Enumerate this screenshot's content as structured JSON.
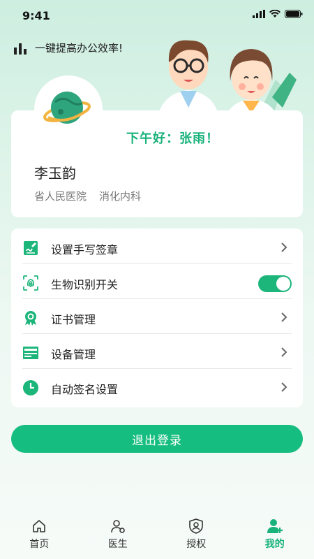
{
  "status_bar": {
    "time": "9:41"
  },
  "header": {
    "slogan": "一键提高办公效率!"
  },
  "profile": {
    "greeting": "下午好：张雨！",
    "name": "李玉韵",
    "hospital": "省人民医院",
    "department": "消化内科"
  },
  "menu": {
    "items": [
      {
        "label": "设置手写签章",
        "icon": "signature-icon"
      },
      {
        "label": "生物识别开关",
        "icon": "fingerprint-icon",
        "toggle_on": true
      },
      {
        "label": "证书管理",
        "icon": "certificate-icon"
      },
      {
        "label": "设备管理",
        "icon": "device-icon"
      },
      {
        "label": "自动签名设置",
        "icon": "clock-icon"
      }
    ]
  },
  "logout": {
    "label": "退出登录"
  },
  "tabs": [
    {
      "label": "首页",
      "icon": "home-icon"
    },
    {
      "label": "医生",
      "icon": "doctor-icon"
    },
    {
      "label": "授权",
      "icon": "authorize-icon"
    },
    {
      "label": "我的",
      "icon": "profile-icon",
      "active": true
    }
  ],
  "colors": {
    "accent": "#19b27b",
    "button": "#16bd80"
  }
}
